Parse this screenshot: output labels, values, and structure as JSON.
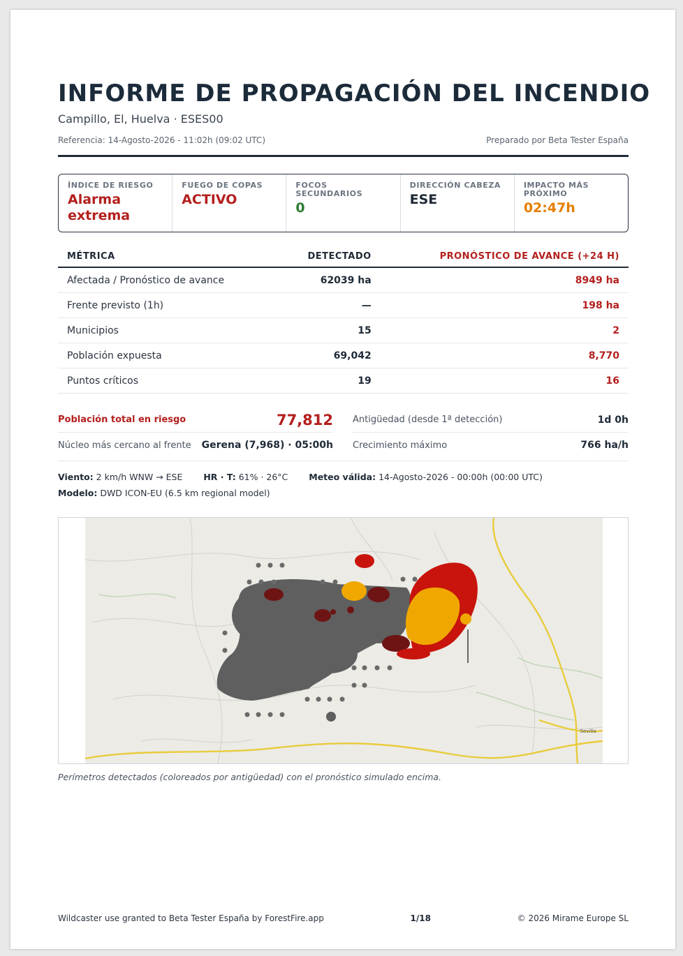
{
  "header": {
    "title": "INFORME DE PROPAGACIÓN DEL INCENDIO",
    "subtitle": "Campillo, El, Huelva · ESES00",
    "reference": "Referencia: 14-Agosto-2026 - 11:02h (09:02 UTC)",
    "prepared_by": "Preparado por Beta Tester España"
  },
  "kpis": [
    {
      "label": "ÍNDICE DE RIESGO",
      "value": "Alarma extrema",
      "color": "#b3201e"
    },
    {
      "label": "FUEGO DE COPAS",
      "value": "ACTIVO",
      "color": "#b3201e"
    },
    {
      "label": "FOCOS SECUNDARIOS",
      "value": "0",
      "color": "#2e7d32"
    },
    {
      "label": "DIRECCIÓN CABEZA",
      "value": "ESE",
      "color": "#1f2a37"
    },
    {
      "label": "IMPACTO MÁS PRÓXIMO",
      "value": "02:47h",
      "color": "#e67e00"
    }
  ],
  "metrics": {
    "headers": {
      "metric": "MÉTRICA",
      "detected": "DETECTADO",
      "forecast": "PRONÓSTICO DE AVANCE (+24 H)"
    },
    "rows": [
      {
        "name": "Afectada / Pronóstico de avance",
        "detected": "62039 ha",
        "forecast": "8949 ha"
      },
      {
        "name": "Frente previsto (1h)",
        "detected": "—",
        "forecast": "198 ha"
      },
      {
        "name": "Municipios",
        "detected": "15",
        "forecast": "2"
      },
      {
        "name": "Población expuesta",
        "detected": "69,042",
        "forecast": "8,770"
      },
      {
        "name": "Puntos críticos",
        "detected": "19",
        "forecast": "16"
      }
    ]
  },
  "summary": {
    "risk_pop_label": "Población total en riesgo",
    "risk_pop_value": "77,812",
    "age_label": "Antigüedad (desde 1ª detección)",
    "age_value": "1d 0h",
    "nucleus_label": "Núcleo más cercano al frente",
    "nucleus_value": "Gerena (7,968) · 05:00h",
    "growth_label": "Crecimiento máximo",
    "growth_value": "766 ha/h"
  },
  "meteo": {
    "wind_label": "Viento:",
    "wind_value": "2 km/h WNW → ESE",
    "hr_label": "HR · T:",
    "hr_value": "61% · 26°C",
    "valid_label": "Meteo válida:",
    "valid_value": "14-Agosto-2026 - 00:00h (00:00 UTC)",
    "model_label": "Modelo:",
    "model_value": "DWD ICON-EU (6.5 km regional model)"
  },
  "map": {
    "place_labels": [
      "Sevilla"
    ],
    "colors": {
      "detected": "#5f5f5f",
      "forecast_core": "#f0a800",
      "forecast_ring": "#c8140c",
      "old": "#6e1414"
    }
  },
  "caption": "Perímetros detectados (coloreados por antigüedad) con el pronóstico simulado encima.",
  "footer": {
    "left": "Wildcaster use granted to Beta Tester España by ForestFire.app",
    "page": "1/18",
    "right": "© 2026 Mirame Europe SL"
  }
}
